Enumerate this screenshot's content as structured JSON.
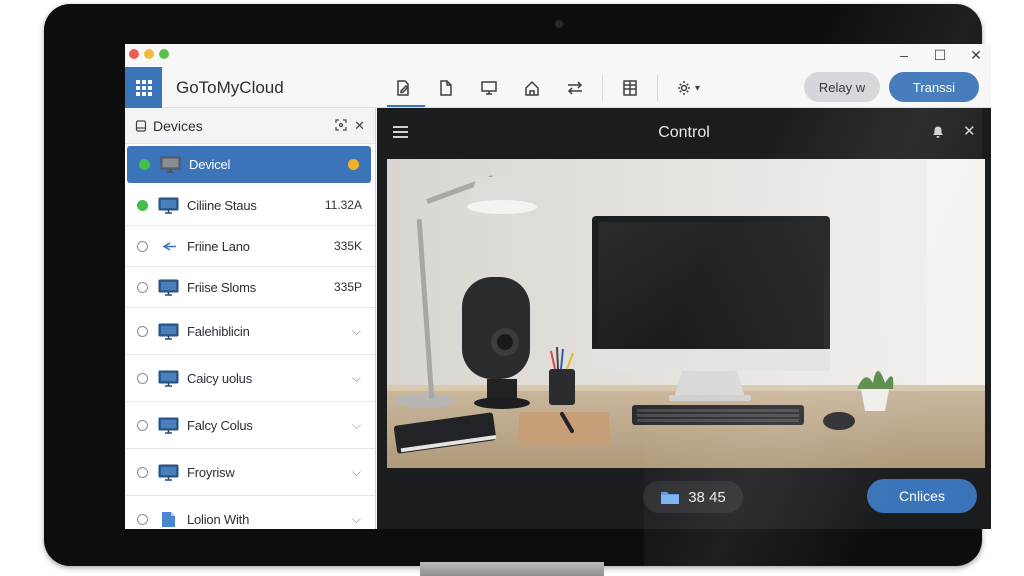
{
  "app": {
    "title": "GoToMyCloud"
  },
  "window_controls": {
    "minimize": "–",
    "maximize": "☐",
    "close": "✕"
  },
  "toolbar": {
    "icons": [
      "file-edit-icon",
      "document-icon",
      "monitor-icon",
      "home-icon",
      "transfer-arrows-icon",
      "spreadsheet-icon",
      "settings-gear-icon"
    ],
    "relay_label": "Relay w",
    "transfer_label": "Transsi",
    "settings_caret": "▾"
  },
  "sidebar": {
    "title": "Devices",
    "header_actions": [
      "✕"
    ],
    "items": [
      {
        "name": "Devicel",
        "status": "online",
        "meta": "",
        "selected": true
      },
      {
        "name": "Ciliine Staus",
        "status": "online",
        "meta": "11.32A"
      },
      {
        "name": "Friine Lano",
        "status": "offline",
        "meta": "335K"
      },
      {
        "name": "Friise Sloms",
        "status": "offline",
        "meta": "335P"
      },
      {
        "name": "Falehiblicin",
        "status": "offline",
        "meta": "⌵"
      },
      {
        "name": "Caicy uolus",
        "status": "offline",
        "meta": "⌵"
      },
      {
        "name": "Falcy Colus",
        "status": "offline",
        "meta": "⌵"
      },
      {
        "name": "Froyrisw",
        "status": "offline",
        "meta": "⌵"
      },
      {
        "name": "Lolion With",
        "status": "offline",
        "meta": "⌵"
      }
    ]
  },
  "control": {
    "title": "Control",
    "bottom_info": "38 45",
    "continue_label": "Cnlices"
  },
  "colors": {
    "accent": "#3b74b8",
    "online": "#43c049",
    "warning": "#f2b12a"
  }
}
